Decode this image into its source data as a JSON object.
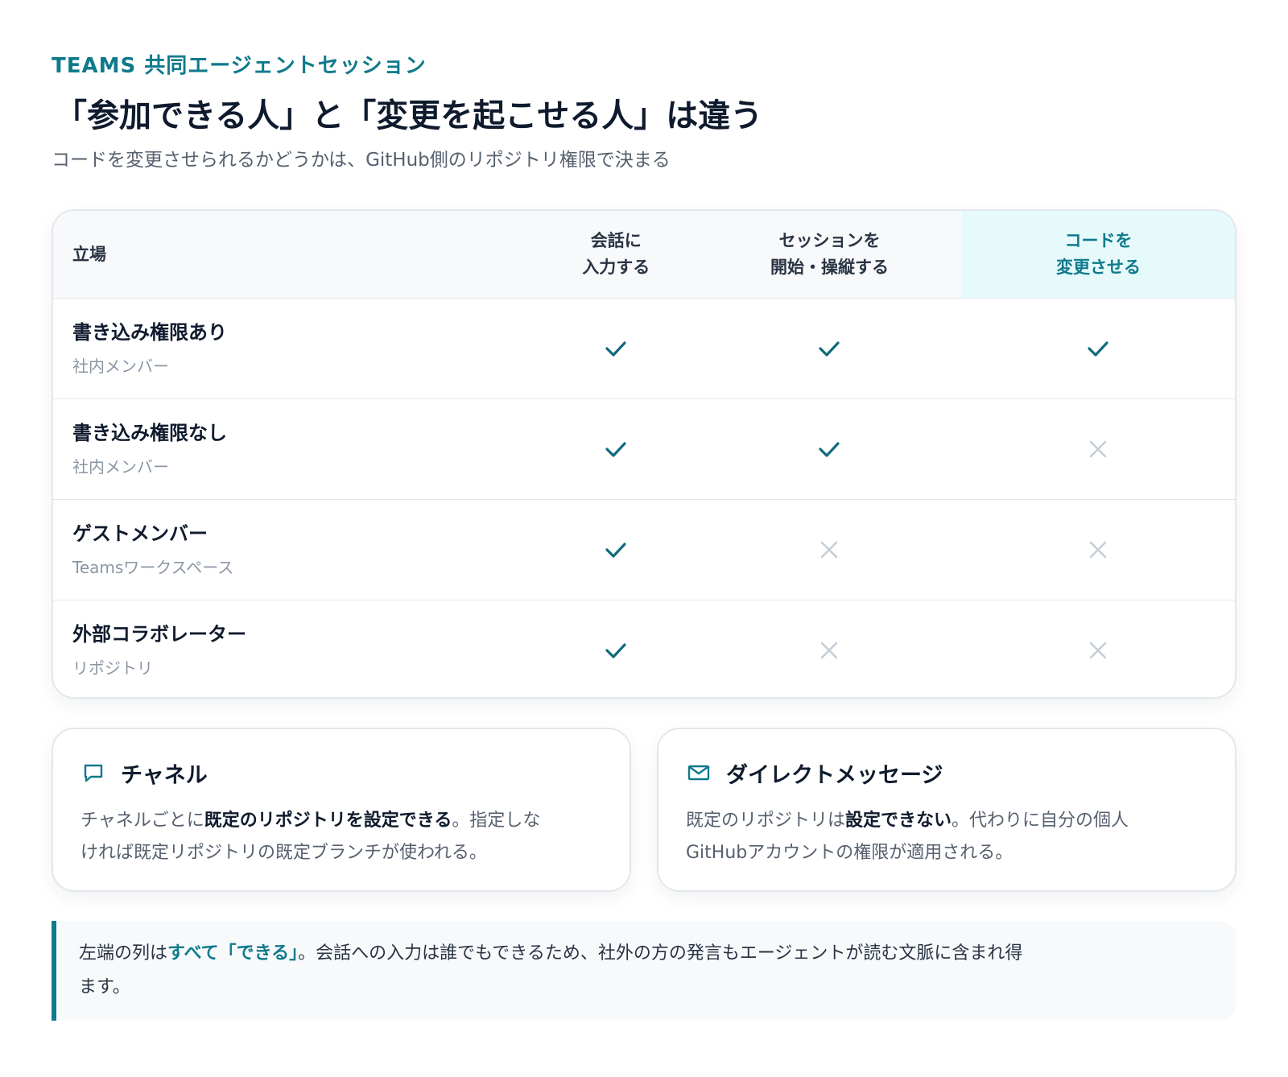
{
  "header": {
    "eyebrow": "TEAMS 共同エージェントセッション",
    "title": "「参加できる人」と「変更を起こせる人」は違う",
    "subtitle": "コードを変更させられるかどうかは、GitHub側のリポジトリ権限で決まる"
  },
  "matrix": {
    "headers": {
      "role": "立場",
      "col1_line1": "会話に",
      "col1_line2": "入力する",
      "col2_line1": "セッションを",
      "col2_line2": "開始・操縦する",
      "col3_line1": "コードを",
      "col3_line2": "変更させる"
    },
    "rows": [
      {
        "role": "書き込み権限あり",
        "scope": "社内メンバー",
        "can": [
          true,
          true,
          true
        ]
      },
      {
        "role": "書き込み権限なし",
        "scope": "社内メンバー",
        "can": [
          true,
          true,
          false
        ]
      },
      {
        "role": "ゲストメンバー",
        "scope": "Teamsワークスペース",
        "can": [
          true,
          false,
          false
        ]
      },
      {
        "role": "外部コラボレーター",
        "scope": "リポジトリ",
        "can": [
          true,
          false,
          false
        ]
      }
    ]
  },
  "cards": {
    "channel": {
      "icon": "chat-bubble-icon",
      "title": "チャネル",
      "body_pre": "チャネルごとに",
      "body_bold": "既定のリポジトリを設定できる",
      "body_post_line1": "。指定しな",
      "body_line2": "ければ既定リポジトリの既定ブランチが使われる。"
    },
    "dm": {
      "icon": "envelope-icon",
      "title": "ダイレクトメッセージ",
      "body_pre": "既定のリポジトリは",
      "body_bold": "設定できない",
      "body_post_line1": "。代わりに自分の個人",
      "body_line2": "GitHubアカウントの権限が適用される。"
    }
  },
  "note": {
    "pre": "左端の列は",
    "highlight": "すべて「できる」",
    "post_line1": "。会話への入力は誰でもできるため、社外の方の発言もエージェントが読む文脈に含まれ得",
    "line2": "ます。"
  },
  "colors": {
    "accent": "#0f7a8c",
    "check": "#0f6b7c",
    "cross": "#c5ced8",
    "border": "#e3e7ec"
  }
}
